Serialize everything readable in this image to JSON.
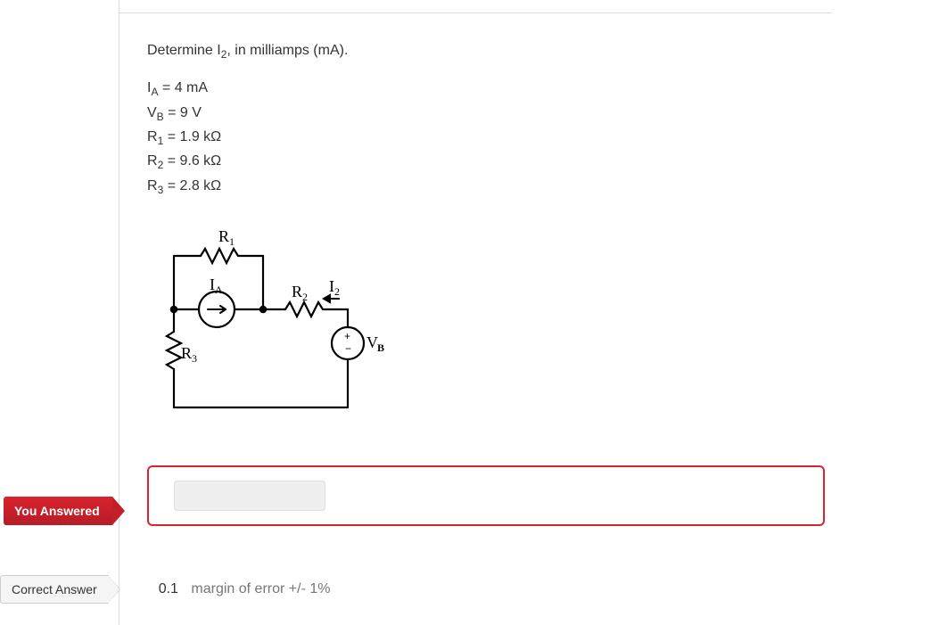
{
  "prompt": "Determine I₂, in milliamps (mA).",
  "given": {
    "ia": "I_A = 4 mA",
    "vb": "V_B = 9 V",
    "r1": "R₁ = 1.9 kΩ",
    "r2": "R₂ = 9.6 kΩ",
    "r3": "R₃ = 2.8 kΩ"
  },
  "circuit_labels": {
    "r1": "R₁",
    "r2": "R₂",
    "r3": "R₃",
    "ia": "I_A",
    "i2": "I₂",
    "vb": "V_B",
    "plus": "+",
    "minus": "−"
  },
  "badges": {
    "you_answered": "You Answered",
    "correct_answer": "Correct Answer"
  },
  "answer_value": "",
  "correct": {
    "value": "0.1",
    "margin": "margin of error +/- 1%"
  }
}
